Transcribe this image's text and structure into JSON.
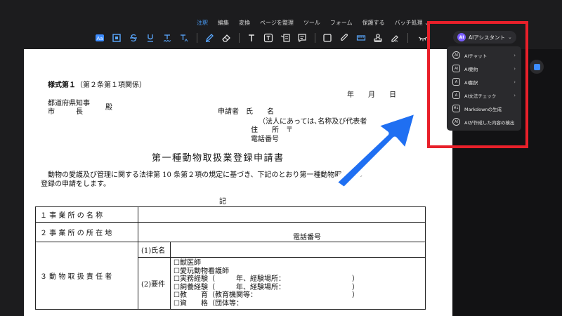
{
  "menu": {
    "items": [
      "注釈",
      "編集",
      "変換",
      "ページを整理",
      "ツール",
      "フォーム",
      "保護する",
      "バッチ処理"
    ],
    "active_index": 0,
    "batch_chevron": "⌄"
  },
  "toolbar": {
    "ai_badge": "AI",
    "ai_label": "AIアシスタント",
    "ai_chevron": "⌄",
    "icons": [
      "text-highlight-icon",
      "area-select-icon",
      "strikethrough-icon",
      "underline-icon",
      "squiggly-icon",
      "caret-text-icon",
      "pen-icon",
      "eraser-icon",
      "text-icon",
      "textbox-icon",
      "callout-icon",
      "note-icon",
      "rectangle-icon",
      "attachment-icon",
      "measure-icon",
      "stamp-icon",
      "signature-icon",
      "eye-hide-icon"
    ]
  },
  "dropdown": {
    "items": [
      {
        "icon": "AI",
        "label": "AIチャット",
        "has_sub": true
      },
      {
        "icon": "AI",
        "label": "AI要約",
        "has_sub": true
      },
      {
        "icon": "A",
        "label": "AI翻訳",
        "has_sub": true
      },
      {
        "icon": "A",
        "label": "AI文法チェック",
        "has_sub": true
      },
      {
        "icon": "M↓",
        "label": "Markdownの生成",
        "has_sub": false
      },
      {
        "icon": "AI",
        "label": "AIが作成した内容の検出",
        "has_sub": false
      }
    ],
    "sub_arrow": "›"
  },
  "document": {
    "form_number_bold": "様式第１",
    "form_number_rest": "（第２条第１項関係）",
    "date_line": "年　　月　　日",
    "addressee_1": "都道府県知事",
    "addressee_2": "市　　　長",
    "honorific": "殿",
    "applicant_label": "申請者　氏　　名",
    "corp_note": "（法人にあっては､名称及び代表者",
    "address_label": "住　　所　〒",
    "phone_label": "電話番号",
    "title": "第一種動物取扱業登録申請書",
    "body_line1": "動物の愛護及び管理に関する法律第 10 条第２項の規定に基づき、下記のとおり第一種動物取扱業の",
    "body_line2": "登録の申請をします。",
    "ki": "記",
    "rows": {
      "r1": "１ 事 業 所 の 名 称",
      "r2": "２ 事 業 所 の 所 在 地",
      "r2_phone": "電話番号",
      "r3": "３ 動 物 取 扱 責 任 者",
      "r3_name": "(1)氏名",
      "r3_req": "(2)要件",
      "req_items": [
        "☐獣医師",
        "☐愛玩動物看護師",
        "☐実務経験（　　　年、経験場所：　　　　　　　　　　）",
        "☐飼養経験（　　　年、経験場所：　　　　　　　　　　）",
        "☐教　　育（教育機関等：　　　　　　　　　　　　　　）",
        "☐資　　格（団体等："
      ]
    }
  },
  "colors": {
    "highlight": "#e8202a",
    "arrow": "#1f6ff2",
    "active_menu": "#4aa0ff"
  }
}
